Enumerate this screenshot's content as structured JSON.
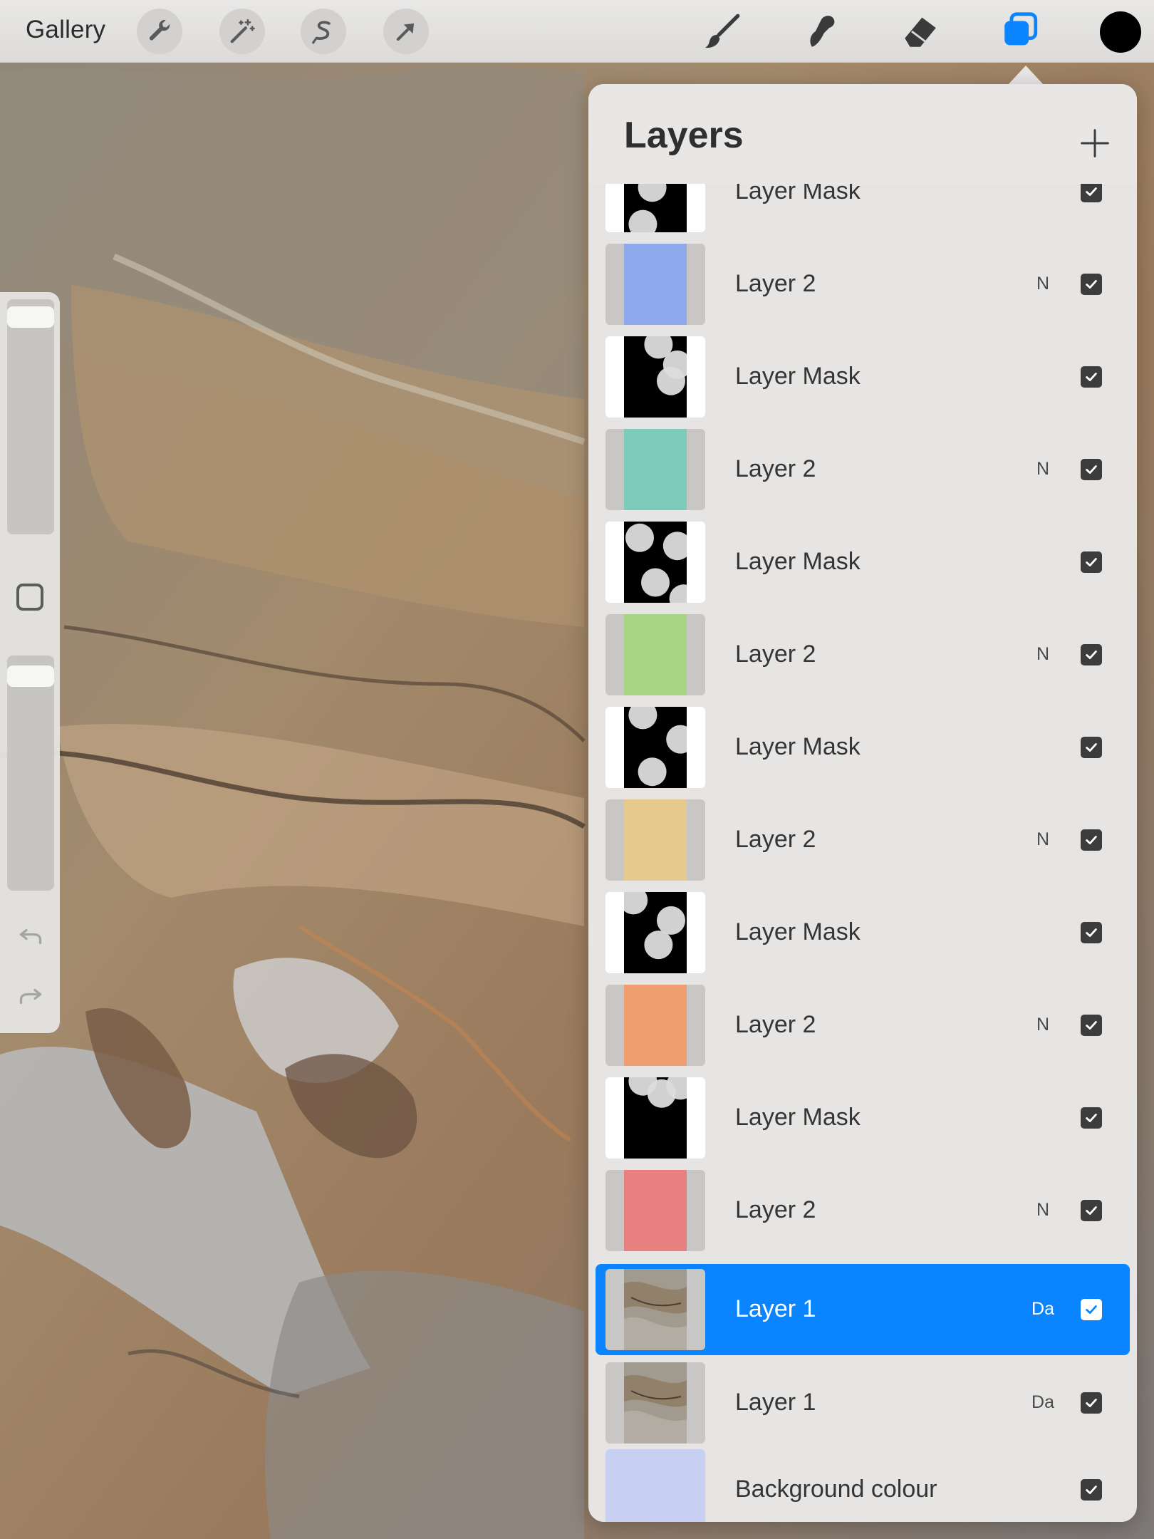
{
  "toolbar": {
    "gallery_label": "Gallery",
    "actions_icon": "wrench-icon",
    "adjustments_icon": "magic-wand-icon",
    "selection_icon": "selection-s-icon",
    "transform_icon": "arrow-cursor-icon",
    "brush_icon": "brush-icon",
    "smudge_icon": "smudge-icon",
    "eraser_icon": "eraser-icon",
    "layers_icon": "layers-icon",
    "current_color": "#000000",
    "accent_color": "#0a84ff"
  },
  "sidebar": {
    "brush_size_icon": "size-slider",
    "opacity_icon": "opacity-slider",
    "modify_icon": "square-modify-icon",
    "undo_icon": "undo-arrow-icon",
    "redo_icon": "redo-arrow-icon"
  },
  "layers_panel": {
    "title": "Layers",
    "add_icon": "plus-icon",
    "layers": [
      {
        "name": "Layer Mask",
        "blend": "",
        "type": "mask",
        "visible": true
      },
      {
        "name": "Layer 2",
        "blend": "N",
        "type": "color",
        "color": "#8eaaed",
        "visible": true
      },
      {
        "name": "Layer Mask",
        "blend": "",
        "type": "mask",
        "visible": true
      },
      {
        "name": "Layer 2",
        "blend": "N",
        "type": "color",
        "color": "#7fcbbb",
        "visible": true
      },
      {
        "name": "Layer Mask",
        "blend": "",
        "type": "mask",
        "visible": true
      },
      {
        "name": "Layer 2",
        "blend": "N",
        "type": "color",
        "color": "#a8d583",
        "visible": true
      },
      {
        "name": "Layer Mask",
        "blend": "",
        "type": "mask",
        "visible": true
      },
      {
        "name": "Layer 2",
        "blend": "N",
        "type": "color",
        "color": "#e6c98c",
        "visible": true
      },
      {
        "name": "Layer Mask",
        "blend": "",
        "type": "mask",
        "visible": true
      },
      {
        "name": "Layer 2",
        "blend": "N",
        "type": "color",
        "color": "#ef9e6f",
        "visible": true
      },
      {
        "name": "Layer Mask",
        "blend": "",
        "type": "mask",
        "visible": true
      },
      {
        "name": "Layer 2",
        "blend": "N",
        "type": "color",
        "color": "#e88080",
        "visible": true
      },
      {
        "name": "Layer 1",
        "blend": "Da",
        "type": "image",
        "visible": true,
        "selected": true
      },
      {
        "name": "Layer 1",
        "blend": "Da",
        "type": "image",
        "visible": true
      },
      {
        "name": "Background colour",
        "blend": "",
        "type": "background",
        "color": "#c8d0f3",
        "visible": true
      }
    ]
  }
}
